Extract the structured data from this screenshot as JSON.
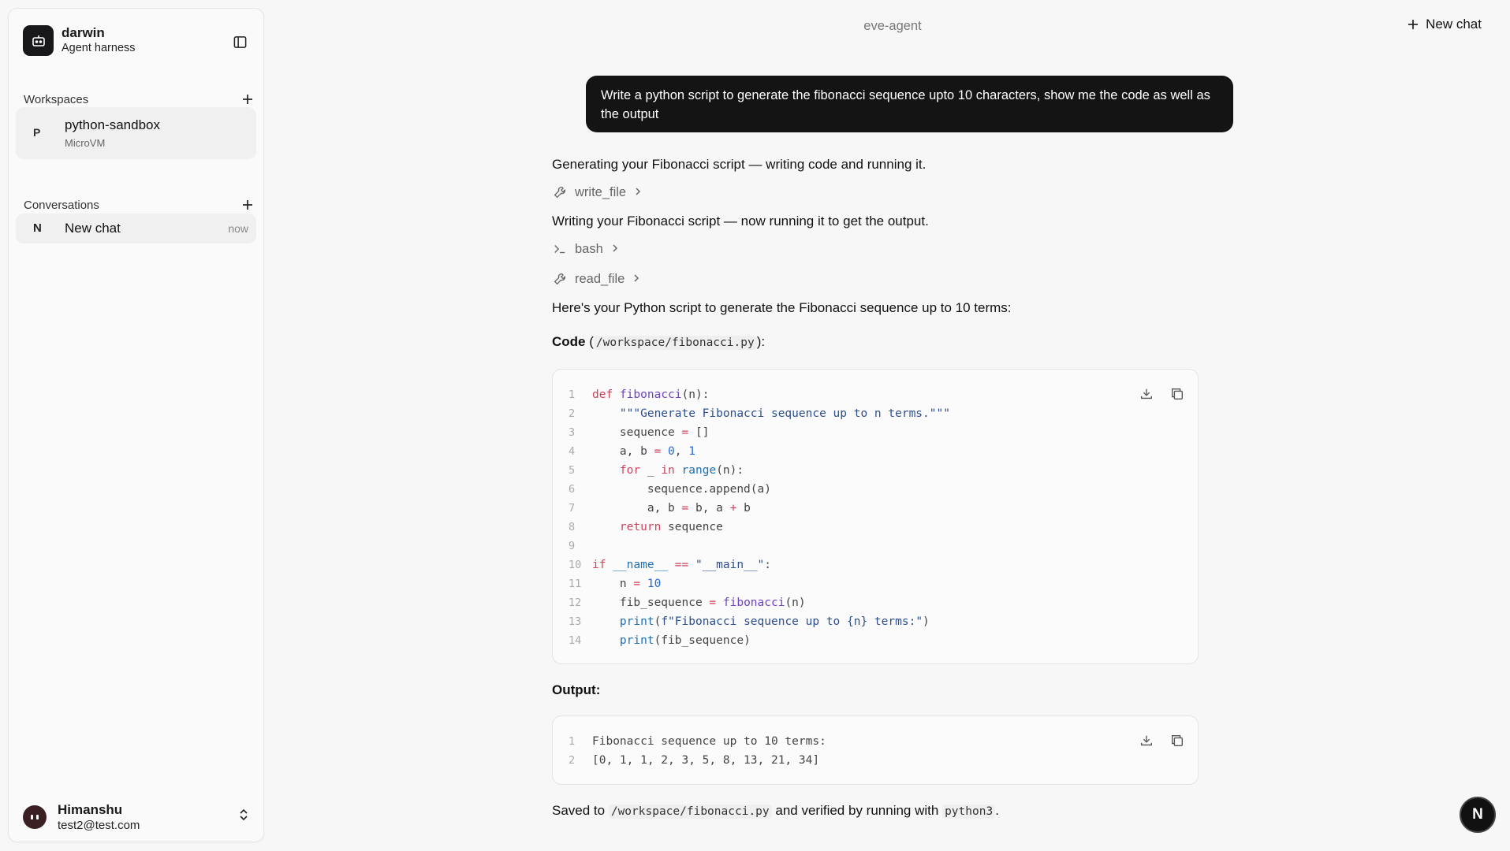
{
  "sidebar": {
    "brand_name": "darwin",
    "brand_sub": "Agent harness",
    "workspaces_title": "Workspaces",
    "workspace": {
      "letter": "P",
      "name": "python-sandbox",
      "type": "MicroVM"
    },
    "conversations_title": "Conversations",
    "conversation": {
      "letter": "N",
      "name": "New chat",
      "time": "now"
    },
    "user": {
      "name": "Himanshu",
      "email": "test2@test.com"
    }
  },
  "header": {
    "title": "eve-agent",
    "new_chat_label": "New chat"
  },
  "user_message": "Write a python script to generate the fibonacci sequence upto 10 characters, show me the code as well as the output",
  "assistant": {
    "msg1": "Generating your Fibonacci script — writing code and running it.",
    "tool1": "write_file",
    "msg2": "Writing your Fibonacci script — now running it to get the output.",
    "tool2": "bash",
    "tool3": "read_file",
    "msg3": "Here's your Python script to generate the Fibonacci sequence up to 10 terms:",
    "code_label": "Code",
    "code_path": "/workspace/fibonacci.py",
    "output_label": "Output:",
    "output_lines": [
      "Fibonacci sequence up to 10 terms:",
      "[0, 1, 1, 2, 3, 5, 8, 13, 21, 34]"
    ],
    "saved_prefix": "Saved to",
    "saved_path": "/workspace/fibonacci.py",
    "saved_middle": "and verified by running with",
    "saved_cmd": "python3",
    "saved_suffix": "."
  },
  "code_lines": [
    "def fibonacci(n):",
    "    \"\"\"Generate Fibonacci sequence up to n terms.\"\"\"",
    "    sequence = []",
    "    a, b = 0, 1",
    "    for _ in range(n):",
    "        sequence.append(a)",
    "        a, b = b, a + b",
    "    return sequence",
    "",
    "if __name__ == \"__main__\":",
    "    n = 10",
    "    fib_sequence = fibonacci(n)",
    "    print(f\"Fibonacci sequence up to {n} terms:\")",
    "    print(fib_sequence)"
  ],
  "fab_letter": "N",
  "icons": [
    "robot-icon",
    "sidebar-toggle-icon",
    "plus-icon",
    "wrench-icon",
    "terminal-icon",
    "chevron-right-icon",
    "download-icon",
    "copy-icon",
    "chevron-up-down-icon"
  ]
}
